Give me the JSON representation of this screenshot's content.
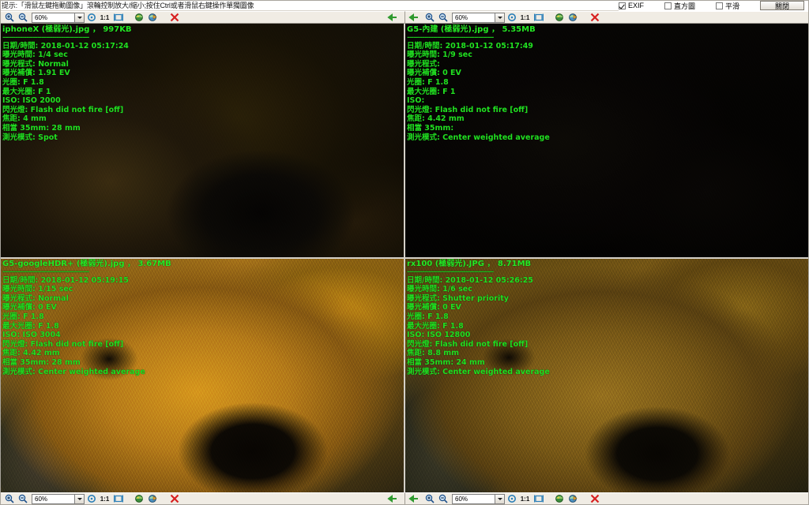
{
  "hint": {
    "text": "提示:「滑鼠左鍵拖動圖像」滾輪控制放大/縮小;按住Ctrl或者滑鼠右鍵操作單獨圖像"
  },
  "options": {
    "exif": {
      "label": "EXIF",
      "checked": true
    },
    "histogram": {
      "label": "直方圖",
      "checked": false
    },
    "smooth": {
      "label": "平滑",
      "checked": false
    },
    "close_label": "關閉"
  },
  "toolbar": {
    "zoom_in": "zoom-in",
    "zoom_out": "zoom-out",
    "zoom_value": "60%",
    "zoom_options": [
      "60%"
    ],
    "rotate": "rotate",
    "ratio_label": "1:1",
    "fit": "fit-to-window",
    "save": "save-image",
    "export": "export-image",
    "close": "close-image",
    "back": "back-arrow"
  },
  "panels": [
    {
      "id": "iphonex",
      "title": "iphoneX (極弱光).jpg ， 997KB",
      "rule": "----------------------------------------",
      "rows": [
        "日期/時間: 2018-01-12 05:17:24",
        "曝光時間: 1/4 sec",
        "曝光程式: Normal",
        "曝光補償: 1.91 EV",
        "光圈: F 1.8",
        "最大光圈: F 1",
        "ISO: ISO 2000",
        "閃光燈: Flash did not fire [off]",
        "焦距: 4 mm",
        "相當 35mm: 28 mm",
        "測光模式: Spot"
      ]
    },
    {
      "id": "g5-builtin",
      "title": "G5-內建 (極弱光).jpg ， 5.35MB",
      "rule": "----------------------------------------",
      "rows": [
        "日期/時間: 2018-01-12 05:17:49",
        "曝光時間: 1/9 sec",
        "曝光程式:",
        "曝光補償: 0 EV",
        "光圈: F 1.8",
        "最大光圈: F 1",
        "ISO:",
        "閃光燈: Flash did not fire [off]",
        "焦距: 4.42 mm",
        "相當 35mm:",
        "測光模式: Center weighted average"
      ]
    },
    {
      "id": "g5-googlehdr",
      "title": "G5-googleHDR+ (極弱光).jpg ， 3.67MB",
      "rule": "----------------------------------------",
      "rows": [
        "日期/時間: 2018-01-12 05:19:15",
        "曝光時間: 1/15 sec",
        "曝光程式: Normal",
        "曝光補償: 0 EV",
        "光圈: F 1.8",
        "最大光圈: F 1.8",
        "ISO: ISO 3004",
        "閃光燈: Flash did not fire [off]",
        "焦距: 4.42 mm",
        "相當 35mm: 28 mm",
        "測光模式: Center weighted average"
      ]
    },
    {
      "id": "rx100",
      "title": "rx100 (極弱光).JPG ， 8.71MB",
      "rule": "----------------------------------------",
      "rows": [
        "日期/時間: 2018-01-12 05:26:25",
        "曝光時間: 1/6 sec",
        "曝光程式: Shutter priority",
        "曝光補償: 0 EV",
        "光圈: F 1.8",
        "最大光圈: F 1.8",
        "ISO: ISO 12800",
        "閃光燈: Flash did not fire [off]",
        "焦距: 8.8 mm",
        "相當 35mm: 24 mm",
        "測光模式: Center weighted average"
      ]
    }
  ],
  "colors": {
    "exif_green": "#21e021",
    "chrome": "#d4d0c8",
    "toolbar": "#f0ece4",
    "close_x": "#d82020",
    "arrow_green": "#2f9a2f"
  }
}
